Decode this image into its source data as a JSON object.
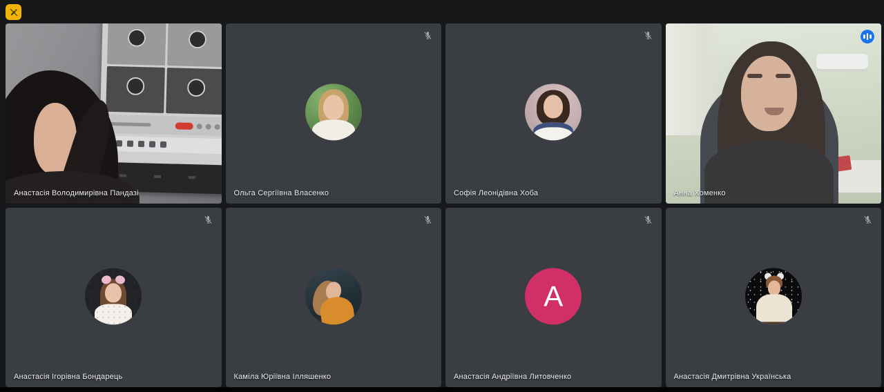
{
  "app": {
    "kind": "video-meeting-grid",
    "background_color": "#17181a",
    "tile_color": "#3a3d42",
    "active_border_color": "#669df6",
    "speaking_badge_color": "#1a73e8",
    "annotation_badge_color": "#f2b307"
  },
  "toolbar": {
    "annotation_icon": "pen-off-icon"
  },
  "icons": {
    "mic_off": "mic-off-icon",
    "speaking": "audio-wave-icon"
  },
  "participants": [
    {
      "name": "Анастасія Володимирівна Пандазі",
      "type": "video",
      "muted": false,
      "speaking": false
    },
    {
      "name": "Ольга Сергіївна Власенко",
      "type": "avatar-photo",
      "muted": true,
      "speaking": false
    },
    {
      "name": "Софія Леонідівна Хоба",
      "type": "avatar-photo",
      "muted": true,
      "speaking": false
    },
    {
      "name": "Анна Хоменко",
      "type": "video",
      "muted": false,
      "speaking": true
    },
    {
      "name": "Анастасія Ігорівна Бондарець",
      "type": "avatar-photo",
      "muted": true,
      "speaking": false
    },
    {
      "name": "Каміла Юріївна Ілляшенко",
      "type": "avatar-photo",
      "muted": true,
      "speaking": false
    },
    {
      "name": "Анастасія Андріївна Литовченко",
      "type": "letter-avatar",
      "letter": "А",
      "letter_bg": "#d03065",
      "muted": true,
      "speaking": false
    },
    {
      "name": "Анастасія Дмитрівна Українська",
      "type": "avatar-photo",
      "muted": true,
      "speaking": false
    }
  ]
}
